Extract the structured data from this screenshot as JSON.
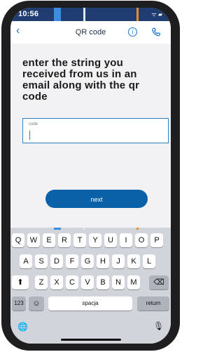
{
  "status_bar": {
    "time": "10:56",
    "icons": "ᯤ ▰"
  },
  "nav": {
    "back_glyph": "‹",
    "title": "QR code",
    "info_glyph": "i"
  },
  "main": {
    "heading": "enter the string you received from us in an email along with the qr code",
    "input_label": "code",
    "input_value": "",
    "next_label": "next"
  },
  "keyboard": {
    "row1": [
      "Q",
      "W",
      "E",
      "R",
      "T",
      "Y",
      "U",
      "I",
      "O",
      "P"
    ],
    "row2": [
      "A",
      "S",
      "D",
      "F",
      "G",
      "H",
      "J",
      "K",
      "L"
    ],
    "row3": [
      "Z",
      "X",
      "C",
      "V",
      "B",
      "N",
      "M"
    ],
    "numbers_label": "123",
    "emoji_glyph": "☺",
    "space_label": "spacja",
    "return_label": "return",
    "shift_glyph": "⬆",
    "delete_glyph": "⌫",
    "globe_glyph": "🌐",
    "mic_glyph": "🎙"
  },
  "colors": {
    "accent": "#0b61a7",
    "status_bar": "#1f3d70",
    "field_border": "#2f7fc1"
  }
}
